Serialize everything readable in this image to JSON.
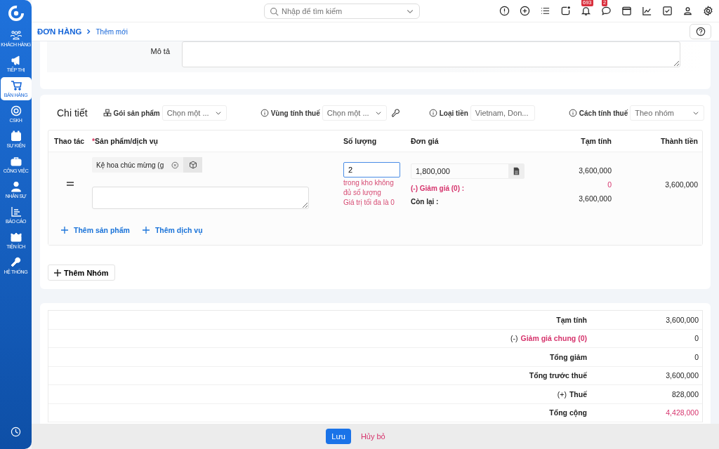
{
  "sidebar": {
    "items": [
      {
        "label": "KHÁCH HÀNG",
        "selected": false
      },
      {
        "label": "TIẾP THỊ",
        "selected": false
      },
      {
        "label": "BÁN HÀNG",
        "selected": true
      },
      {
        "label": "CSKH",
        "selected": false
      },
      {
        "label": "SỰ KIỆN",
        "selected": false
      },
      {
        "label": "CÔNG VIỆC",
        "selected": false
      },
      {
        "label": "NHÂN SỰ",
        "selected": false
      },
      {
        "label": "BÁO CÁO",
        "selected": false
      },
      {
        "label": "TIỆN ÍCH",
        "selected": false
      },
      {
        "label": "HỆ THỐNG",
        "selected": false
      }
    ]
  },
  "topbar": {
    "search": {
      "placeholder": "Nhập để tìm kiếm"
    },
    "notifications_badge": "693",
    "messages_badge": "2"
  },
  "breadcrumb": {
    "section": "ĐƠN HÀNG",
    "page": "Thêm mới"
  },
  "description": {
    "label": "Mô tả"
  },
  "details": {
    "title": "Chi tiết",
    "filters": [
      {
        "kind": "bundle",
        "label": "Gói sản phẩm",
        "value": "Chọn một ...",
        "tool_button": false
      },
      {
        "kind": "info",
        "label": "Vùng tính thuế",
        "value": "Chọn một ...",
        "tool_button": true
      },
      {
        "kind": "info",
        "label": "Loại tiền",
        "value": "Vietnam, Don...",
        "tool_button": false
      },
      {
        "kind": "info",
        "label": "Cách tính thuế",
        "value": "Theo nhóm",
        "tool_button": false
      }
    ],
    "columns": [
      {
        "label": "Thao tác"
      },
      {
        "label": "Sản phẩm/dịch vụ",
        "required_mark": "*"
      },
      {
        "label": "Số lượng"
      },
      {
        "label": "Đơn giá"
      },
      {
        "label": "Tạm tính"
      },
      {
        "label": "Thành tiền"
      }
    ],
    "rows": [
      {
        "product": "Kệ hoa chúc mừng (g",
        "quantity": "2",
        "quantity_errors": [
          "trong kho không đủ số lượng",
          "Giá trị tối đa là 0"
        ],
        "unit_price": "1,800,000",
        "subtotal": "3,600,000",
        "discount_label": "(-) Giảm giá (0) :",
        "discount_value": "0",
        "remaining_label": "Còn lại :",
        "remaining_value": "3,600,000",
        "total": "3,600,000"
      }
    ],
    "add_links": [
      "Thêm sản phẩm",
      "Thêm dịch vụ"
    ],
    "add_group": "Thêm Nhóm"
  },
  "summary": [
    {
      "label": "Tạm tính",
      "link": false,
      "value": "3,600,000",
      "highlight": false
    },
    {
      "prefix": "(-)",
      "label": "Giảm giá chung (0)",
      "link": true,
      "value": "0",
      "highlight": false
    },
    {
      "label": "Tổng giảm",
      "link": false,
      "value": "0",
      "highlight": false
    },
    {
      "label": "Tổng trước thuế",
      "link": false,
      "value": "3,600,000",
      "highlight": false
    },
    {
      "prefix": "(+)",
      "label": "Thuế",
      "link": false,
      "value": "828,000",
      "highlight": false
    },
    {
      "label": "Tổng cộng",
      "link": false,
      "value": "4,428,000",
      "highlight": true
    }
  ],
  "footer": {
    "save": "Lưu",
    "cancel": "Hủy bỏ"
  }
}
